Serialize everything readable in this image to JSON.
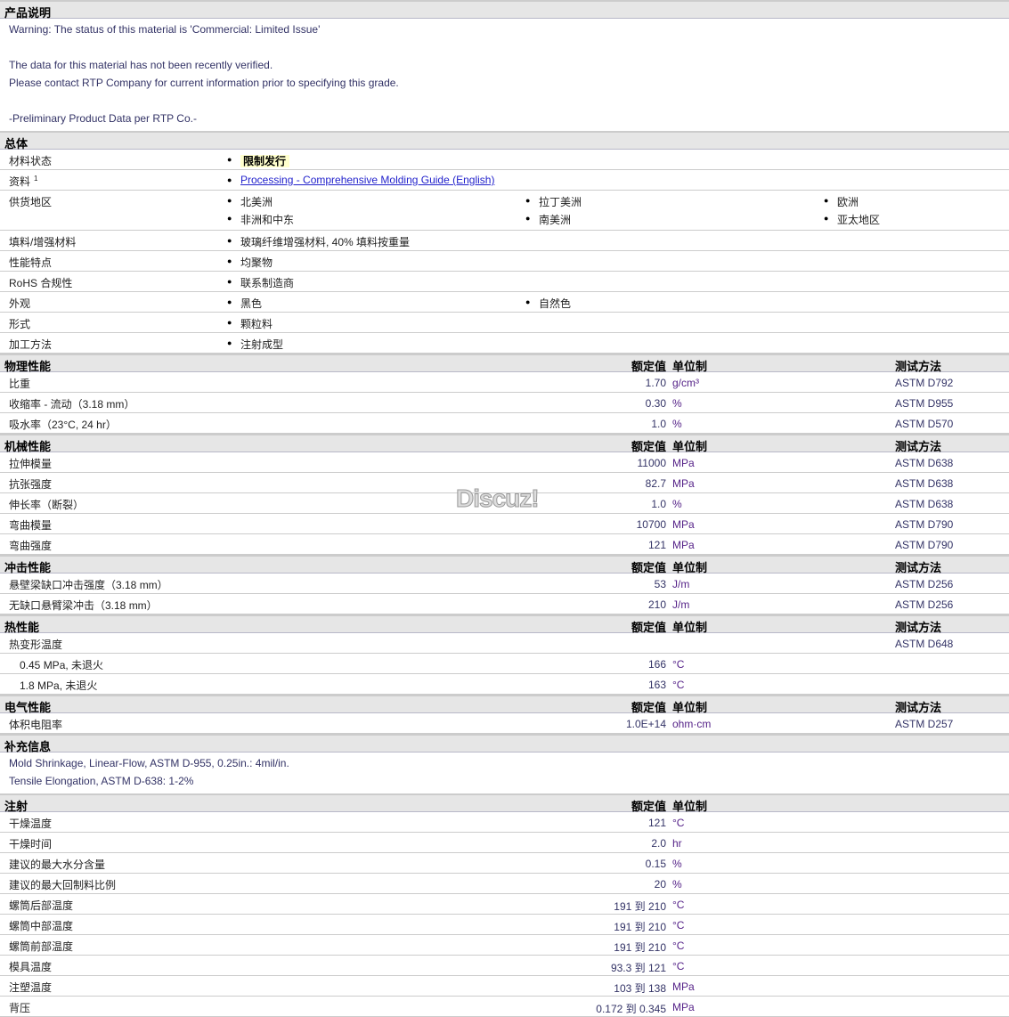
{
  "sections": [
    {
      "title": "产品说明",
      "type": "text",
      "lines": [
        "Warning: The status of this material is 'Commercial: Limited Issue'",
        "",
        "The data for this material has not been recently verified.",
        "Please contact RTP Company for current information prior to specifying this grade.",
        "",
        "-Preliminary Product Data per RTP Co.-"
      ]
    },
    {
      "title": "总体",
      "type": "general",
      "rows": [
        {
          "label": "材料状态",
          "items": [
            [
              "限制发行"
            ]
          ],
          "style": "highlight"
        },
        {
          "label": "资料",
          "sup": "1",
          "items": [
            [
              "Processing - Comprehensive Molding Guide (English)"
            ]
          ],
          "style": "link"
        },
        {
          "label": "供货地区",
          "items": [
            [
              "北美洲",
              "拉丁美洲",
              "欧洲"
            ],
            [
              "非洲和中东",
              "南美洲",
              "亚太地区"
            ]
          ]
        },
        {
          "label": "填料/增强材料",
          "items": [
            [
              "玻璃纤维增强材料, 40% 填料按重量"
            ]
          ]
        },
        {
          "label": "性能特点",
          "items": [
            [
              "均聚物"
            ]
          ]
        },
        {
          "label": "RoHS 合规性",
          "items": [
            [
              "联系制造商"
            ]
          ]
        },
        {
          "label": "外观",
          "items": [
            [
              "黑色",
              "自然色"
            ]
          ]
        },
        {
          "label": "形式",
          "items": [
            [
              "颗粒料"
            ]
          ]
        },
        {
          "label": "加工方法",
          "items": [
            [
              "注射成型"
            ]
          ]
        }
      ]
    },
    {
      "title": "物理性能",
      "type": "props",
      "h_value": "额定值",
      "h_unit": "单位制",
      "h_method": "测试方法",
      "rows": [
        {
          "label": "比重",
          "value": "1.70",
          "unit": "g/cm³",
          "method": "ASTM D792"
        },
        {
          "label": "收缩率 - 流动（3.18 mm）",
          "value": "0.30",
          "unit": "%",
          "method": "ASTM D955"
        },
        {
          "label": "吸水率（23°C, 24 hr）",
          "value": "1.0",
          "unit": "%",
          "method": "ASTM D570"
        }
      ]
    },
    {
      "title": "机械性能",
      "type": "props",
      "h_value": "额定值",
      "h_unit": "单位制",
      "h_method": "测试方法",
      "rows": [
        {
          "label": "拉伸模量",
          "value": "11000",
          "unit": "MPa",
          "method": "ASTM D638"
        },
        {
          "label": "抗张强度",
          "value": "82.7",
          "unit": "MPa",
          "method": "ASTM D638"
        },
        {
          "label": "伸长率（断裂）",
          "value": "1.0",
          "unit": "%",
          "method": "ASTM D638"
        },
        {
          "label": "弯曲模量",
          "value": "10700",
          "unit": "MPa",
          "method": "ASTM D790"
        },
        {
          "label": "弯曲强度",
          "value": "121",
          "unit": "MPa",
          "method": "ASTM D790"
        }
      ]
    },
    {
      "title": "冲击性能",
      "type": "props",
      "h_value": "额定值",
      "h_unit": "单位制",
      "h_method": "测试方法",
      "rows": [
        {
          "label": "悬壁梁缺口冲击强度（3.18 mm）",
          "value": "53",
          "unit": "J/m",
          "method": "ASTM D256"
        },
        {
          "label": "无缺口悬臂梁冲击（3.18 mm）",
          "value": "210",
          "unit": "J/m",
          "method": "ASTM D256"
        }
      ]
    },
    {
      "title": "热性能",
      "type": "props",
      "h_value": "额定值",
      "h_unit": "单位制",
      "h_method": "测试方法",
      "rows": [
        {
          "label": "热变形温度",
          "value": "",
          "unit": "",
          "method": "ASTM D648"
        },
        {
          "label": "0.45 MPa, 未退火",
          "indent": true,
          "value": "166",
          "unit": "°C",
          "method": ""
        },
        {
          "label": "1.8 MPa, 未退火",
          "indent": true,
          "value": "163",
          "unit": "°C",
          "method": ""
        }
      ]
    },
    {
      "title": "电气性能",
      "type": "props",
      "h_value": "额定值",
      "h_unit": "单位制",
      "h_method": "测试方法",
      "rows": [
        {
          "label": "体积电阻率",
          "value": "1.0E+14",
          "unit": "ohm·cm",
          "method": "ASTM D257"
        }
      ]
    },
    {
      "title": "补充信息",
      "type": "text",
      "lines": [
        "Mold Shrinkage, Linear-Flow, ASTM D-955, 0.25in.: 4mil/in.",
        "Tensile Elongation, ASTM D-638: 1-2%"
      ]
    },
    {
      "title": "注射",
      "type": "props",
      "h_value": "额定值",
      "h_unit": "单位制",
      "h_method": "",
      "rows": [
        {
          "label": "干燥温度",
          "value": "121",
          "unit": "°C",
          "method": ""
        },
        {
          "label": "干燥时间",
          "value": "2.0",
          "unit": "hr",
          "method": ""
        },
        {
          "label": "建议的最大水分含量",
          "value": "0.15",
          "unit": "%",
          "method": ""
        },
        {
          "label": "建议的最大回制料比例",
          "value": "20",
          "unit": "%",
          "method": ""
        },
        {
          "label": "螺筒后部温度",
          "value": "191 到  210",
          "unit": "°C",
          "method": ""
        },
        {
          "label": "螺筒中部温度",
          "value": "191 到  210",
          "unit": "°C",
          "method": ""
        },
        {
          "label": "螺筒前部温度",
          "value": "191 到  210",
          "unit": "°C",
          "method": ""
        },
        {
          "label": "模具温度",
          "value": "93.3 到  121",
          "unit": "°C",
          "method": ""
        },
        {
          "label": "注塑温度",
          "value": "103 到  138",
          "unit": "MPa",
          "method": ""
        },
        {
          "label": "背压",
          "value": "0.172 到  0.345",
          "unit": "MPa",
          "method": ""
        }
      ]
    }
  ],
  "watermark": "Discuz!"
}
